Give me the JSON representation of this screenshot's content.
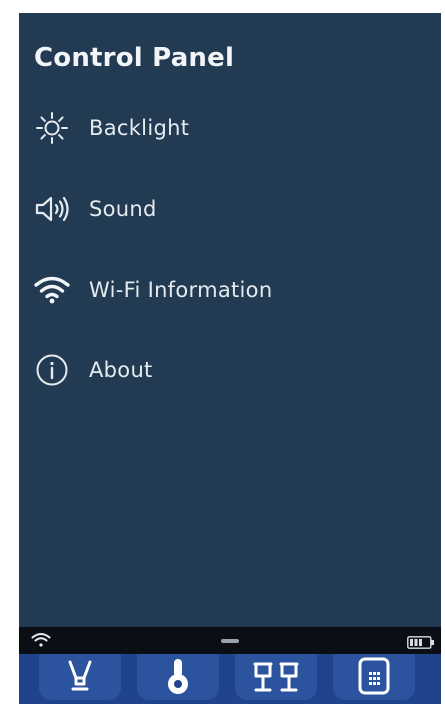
{
  "panel": {
    "title": "Control Panel",
    "items": [
      {
        "label": "Backlight",
        "icon": "sun-icon"
      },
      {
        "label": "Sound",
        "icon": "speaker-icon"
      },
      {
        "label": "Wi-Fi Information",
        "icon": "wifi-icon"
      },
      {
        "label": "About",
        "icon": "info-icon"
      }
    ]
  },
  "status_bar": {
    "left_icon": "wifi-icon",
    "center_icon": "drag-handle-icon",
    "right_icon": "battery-icon"
  },
  "dock": {
    "buttons": [
      "lightbulb-icon",
      "thermometer-icon",
      "plug-icon",
      "remote-icon"
    ]
  },
  "colors": {
    "panel_background": "#223a52",
    "text": "#e6ebf0",
    "status_bar": "#0b0f15",
    "dock": "#20448c"
  }
}
